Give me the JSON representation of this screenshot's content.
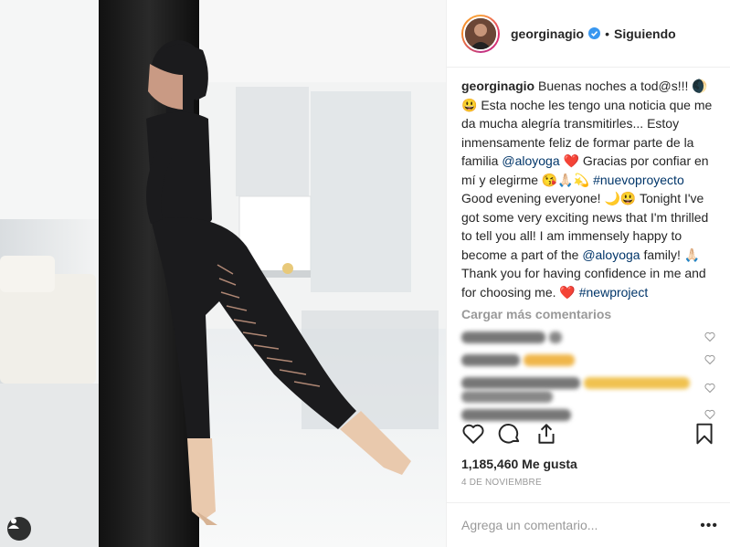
{
  "post": {
    "author": "georginagio",
    "follow_label": "Siguiendo",
    "separator": "•",
    "caption_user": "georginagio",
    "caption_part1": "Buenas noches a tod@s!!! 🌒 😃 Esta noche les tengo una noticia que me da mucha alegría transmitirles... Estoy inmensamente feliz de formar parte de la familia ",
    "mention1": "@aloyoga",
    "caption_part2": " ❤️ Gracias por confiar en mí y elegirme 😘🙏🏻💫 ",
    "hashtag1": "#nuevoproyecto",
    "caption_part3": " Good evening everyone! 🌙😃 Tonight I've got some very exciting news that I'm thrilled to tell you all! I am immensely happy to become a part of the ",
    "mention2": "@aloyoga",
    "caption_part4": " family! 🙏🏻 Thank you for having confidence in me and for choosing me. ❤️ ",
    "hashtag2": "#newproject",
    "load_more": "Cargar más comentarios",
    "likes": "1,185,460 Me gusta",
    "date": "4 DE NOVIEMBRE",
    "comment_placeholder": "Agrega un comentario...",
    "more_options": "•••"
  },
  "icons": [
    "tag-user-icon",
    "verified-badge-icon",
    "heart-icon",
    "comment-icon",
    "share-icon",
    "bookmark-icon",
    "heart-small-icon"
  ],
  "colors": {
    "link": "#003569",
    "muted": "#999999",
    "verified": "#3897f0",
    "border": "#efefef"
  }
}
